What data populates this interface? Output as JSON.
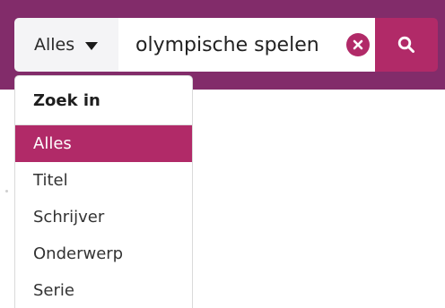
{
  "search": {
    "scope_label": "Alles",
    "query": "olympische spelen",
    "clear_icon": "times-circle-icon",
    "search_icon": "search-icon"
  },
  "dropdown": {
    "header": "Zoek in",
    "items": [
      {
        "label": "Alles",
        "selected": true
      },
      {
        "label": "Titel",
        "selected": false
      },
      {
        "label": "Schrijver",
        "selected": false
      },
      {
        "label": "Onderwerp",
        "selected": false
      },
      {
        "label": "Serie",
        "selected": false
      }
    ]
  },
  "colors": {
    "band": "#822c6a",
    "accent": "#b12a68",
    "scope_bg": "#f4f4f6"
  }
}
